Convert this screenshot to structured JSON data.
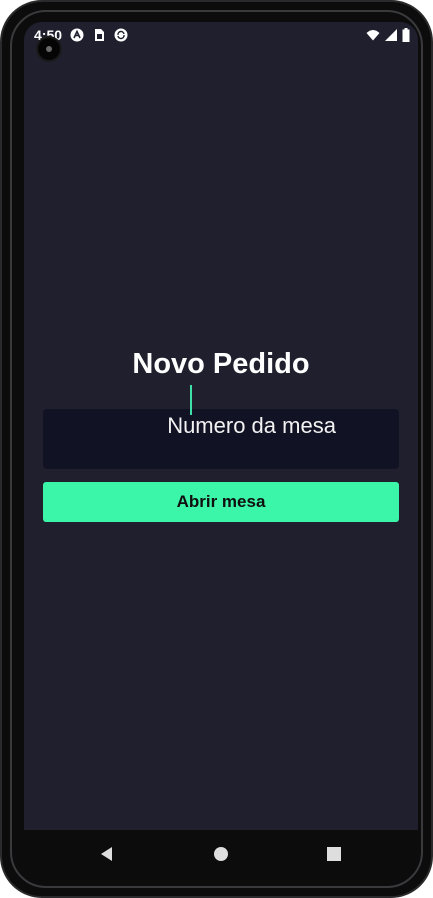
{
  "status_bar": {
    "time": "4:50"
  },
  "screen": {
    "title": "Novo Pedido",
    "table_input": {
      "placeholder": "Numero da mesa",
      "value": ""
    },
    "open_button_label": "Abrir mesa"
  },
  "colors": {
    "background": "#1f1f2e",
    "input_background": "#121225",
    "accent": "#3bf5a9",
    "text": "#ffffff"
  },
  "icons": {
    "status_left": [
      "android-notification-icon",
      "sim-card-icon",
      "sync-icon"
    ],
    "status_right": [
      "wifi-icon",
      "cell-signal-icon",
      "battery-icon"
    ],
    "nav": [
      "back-icon",
      "home-icon",
      "recents-icon"
    ]
  }
}
